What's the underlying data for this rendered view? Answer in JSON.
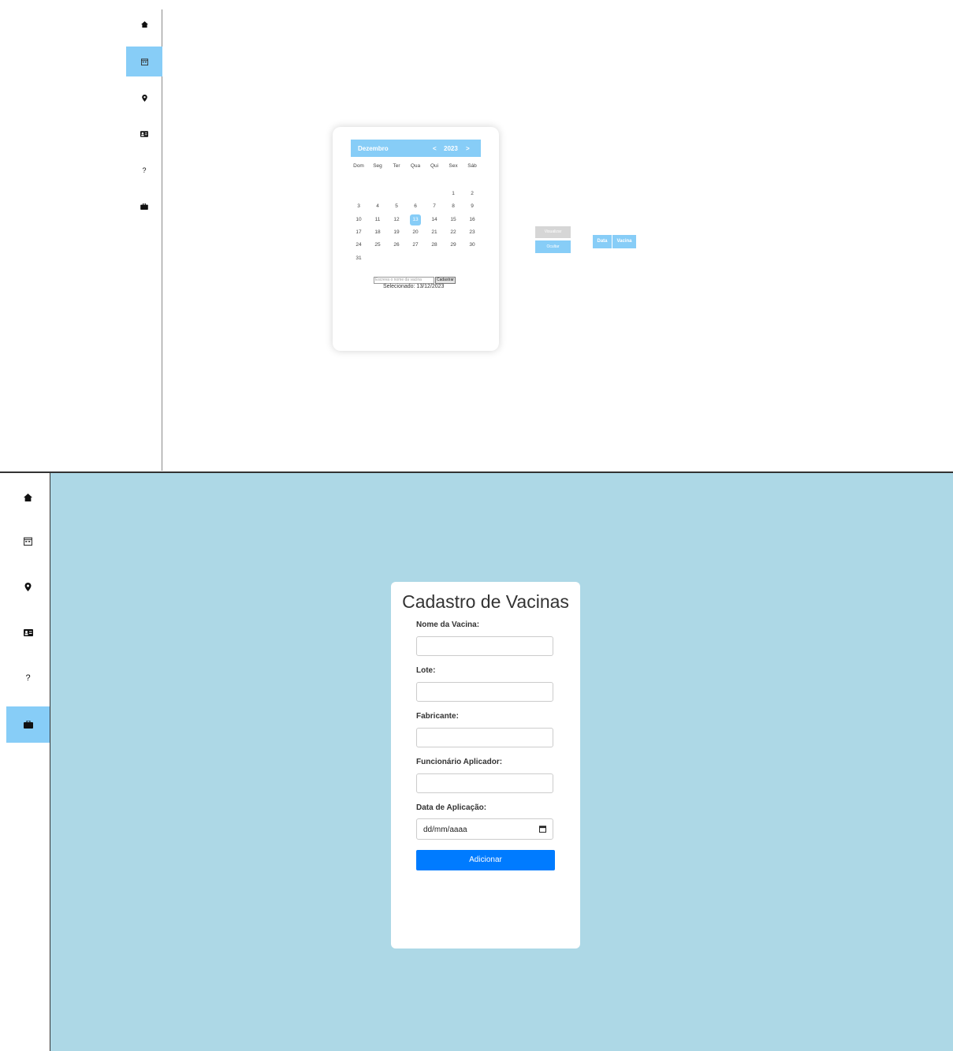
{
  "top": {
    "sidebar": {
      "items": [
        {
          "id": "home",
          "icon": "home-icon"
        },
        {
          "id": "calendar",
          "icon": "calendar-icon",
          "active": true
        },
        {
          "id": "location",
          "icon": "map-pin-icon"
        },
        {
          "id": "profile",
          "icon": "id-card-icon"
        },
        {
          "id": "help",
          "icon": "question-icon",
          "label": "?"
        },
        {
          "id": "vaccines",
          "icon": "briefcase-icon"
        }
      ]
    },
    "calendar": {
      "month": "Dezembro",
      "prev": "<",
      "year": "2023",
      "next": ">",
      "weekdays": [
        "Dom",
        "Seg",
        "Ter",
        "Qua",
        "Qui",
        "Sex",
        "Sáb"
      ],
      "first_weekday_index": 5,
      "days": [
        "1",
        "2",
        "3",
        "4",
        "5",
        "6",
        "7",
        "8",
        "9",
        "10",
        "11",
        "12",
        "13",
        "14",
        "15",
        "16",
        "17",
        "18",
        "19",
        "20",
        "21",
        "22",
        "23",
        "24",
        "25",
        "26",
        "27",
        "28",
        "29",
        "30",
        "31"
      ],
      "selected_day": "13",
      "input_placeholder": "Escreva o nome da vacina",
      "register_button": "Cadastrar",
      "selected_text": "Selecionado: 13/12/2023"
    },
    "side_buttons": {
      "view": "Visualizar",
      "hide": "Ocultar"
    },
    "tabs": [
      "Data",
      "Vacina"
    ]
  },
  "bottom": {
    "sidebar": {
      "items": [
        {
          "id": "home",
          "icon": "home-icon"
        },
        {
          "id": "calendar",
          "icon": "calendar-icon"
        },
        {
          "id": "location",
          "icon": "map-pin-icon"
        },
        {
          "id": "profile",
          "icon": "id-card-icon"
        },
        {
          "id": "help",
          "icon": "question-icon",
          "label": "?"
        },
        {
          "id": "vaccines",
          "icon": "briefcase-icon",
          "active": true
        }
      ]
    },
    "form": {
      "title": "Cadastro de Vacinas",
      "fields": [
        {
          "label": "Nome da Vacina:",
          "value": ""
        },
        {
          "label": "Lote:",
          "value": ""
        },
        {
          "label": "Fabricante:",
          "value": ""
        },
        {
          "label": "Funcionário Aplicador:",
          "value": ""
        }
      ],
      "date_label": "Data de Aplicação:",
      "date_placeholder": "dd/mm/aaaa",
      "submit": "Adicionar"
    }
  },
  "colors": {
    "accent": "#87cdf7",
    "main_bg": "#add8e6",
    "primary_button": "#007bff"
  }
}
